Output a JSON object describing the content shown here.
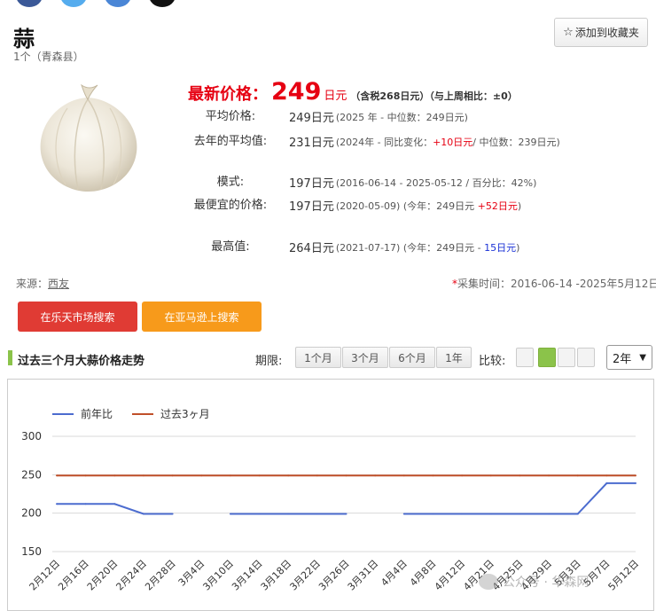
{
  "product": {
    "title": "蒜",
    "subtitle": "1个（青森县）",
    "favorite_label": "添加到收藏夹"
  },
  "price": {
    "latest_label": "最新价格：",
    "latest_value": "249",
    "latest_unit": "日元",
    "latest_note": "（含税268日元）（与上周相比：±0）",
    "rows": [
      {
        "label": "平均价格:",
        "value": "249日元",
        "note": "(2025 年 - 中位数：249日元)"
      },
      {
        "label": "去年的平均值:",
        "value": "231日元",
        "note_a": "(2024年 - 同比变化：",
        "note_red": "+10日元",
        "note_b": "/ 中位数：239日元)"
      },
      {
        "label": "模式:",
        "value": "197日元",
        "note": "(2016-06-14 - 2025-05-12 / 百分比：42%)"
      },
      {
        "label": "最便宜的价格:",
        "value": "197日元",
        "note_a": "(2020-05-09)   (今年：249日元 ",
        "note_red": "+52日元",
        "note_b": ")"
      },
      {
        "label": "最高值:",
        "value": "264日元",
        "note_a": "(2021-07-17) (今年：249日元 - ",
        "note_blue": "15日元",
        "note_b": ")"
      }
    ]
  },
  "source": {
    "label": "来源：",
    "link": "西友"
  },
  "collection": {
    "asterisk": "*",
    "text": "采集时间：2016-06-14 -2025年5月12日"
  },
  "buttons": {
    "rakuten": "在乐天市场搜索",
    "amazon": "在亚马逊上搜索"
  },
  "trend": {
    "title": "过去三个月大蒜价格走势",
    "period_label": "期限:",
    "periods": [
      "1个月",
      "3个月",
      "6个月",
      "1年"
    ],
    "compare_label": "比较:",
    "select_value": "2年"
  },
  "colors": {
    "accent_red": "#e60012",
    "blue": "#1a31d6",
    "green": "#8bc34a",
    "prev_year": "#4c6ccf",
    "past3m": "#c0502a"
  },
  "chart_data": {
    "type": "line",
    "title": "",
    "xlabel": "",
    "ylabel": "",
    "ylim": [
      150,
      300
    ],
    "yticks": [
      150,
      200,
      250,
      300
    ],
    "grid": true,
    "legend_position": "top-left",
    "categories": [
      "2月12日",
      "2月16日",
      "2月20日",
      "2月24日",
      "2月28日",
      "3月4日",
      "3月10日",
      "3月14日",
      "3月18日",
      "3月22日",
      "3月26日",
      "3月31日",
      "4月4日",
      "4月8日",
      "4月12日",
      "4月21日",
      "4月25日",
      "4月29日",
      "5月3日",
      "5月7日",
      "5月12日"
    ],
    "series": [
      {
        "name": "前年比",
        "color": "#4c6ccf",
        "values": [
          212,
          212,
          212,
          199,
          199,
          null,
          199,
          199,
          199,
          199,
          199,
          null,
          199,
          199,
          199,
          199,
          199,
          199,
          199,
          239,
          239
        ]
      },
      {
        "name": "过去3ヶ月",
        "color": "#c0502a",
        "values": [
          249,
          249,
          249,
          249,
          249,
          249,
          249,
          249,
          249,
          249,
          249,
          249,
          249,
          249,
          249,
          249,
          249,
          249,
          249,
          249,
          249
        ]
      }
    ]
  },
  "watermark": "公众号 · 华森网"
}
